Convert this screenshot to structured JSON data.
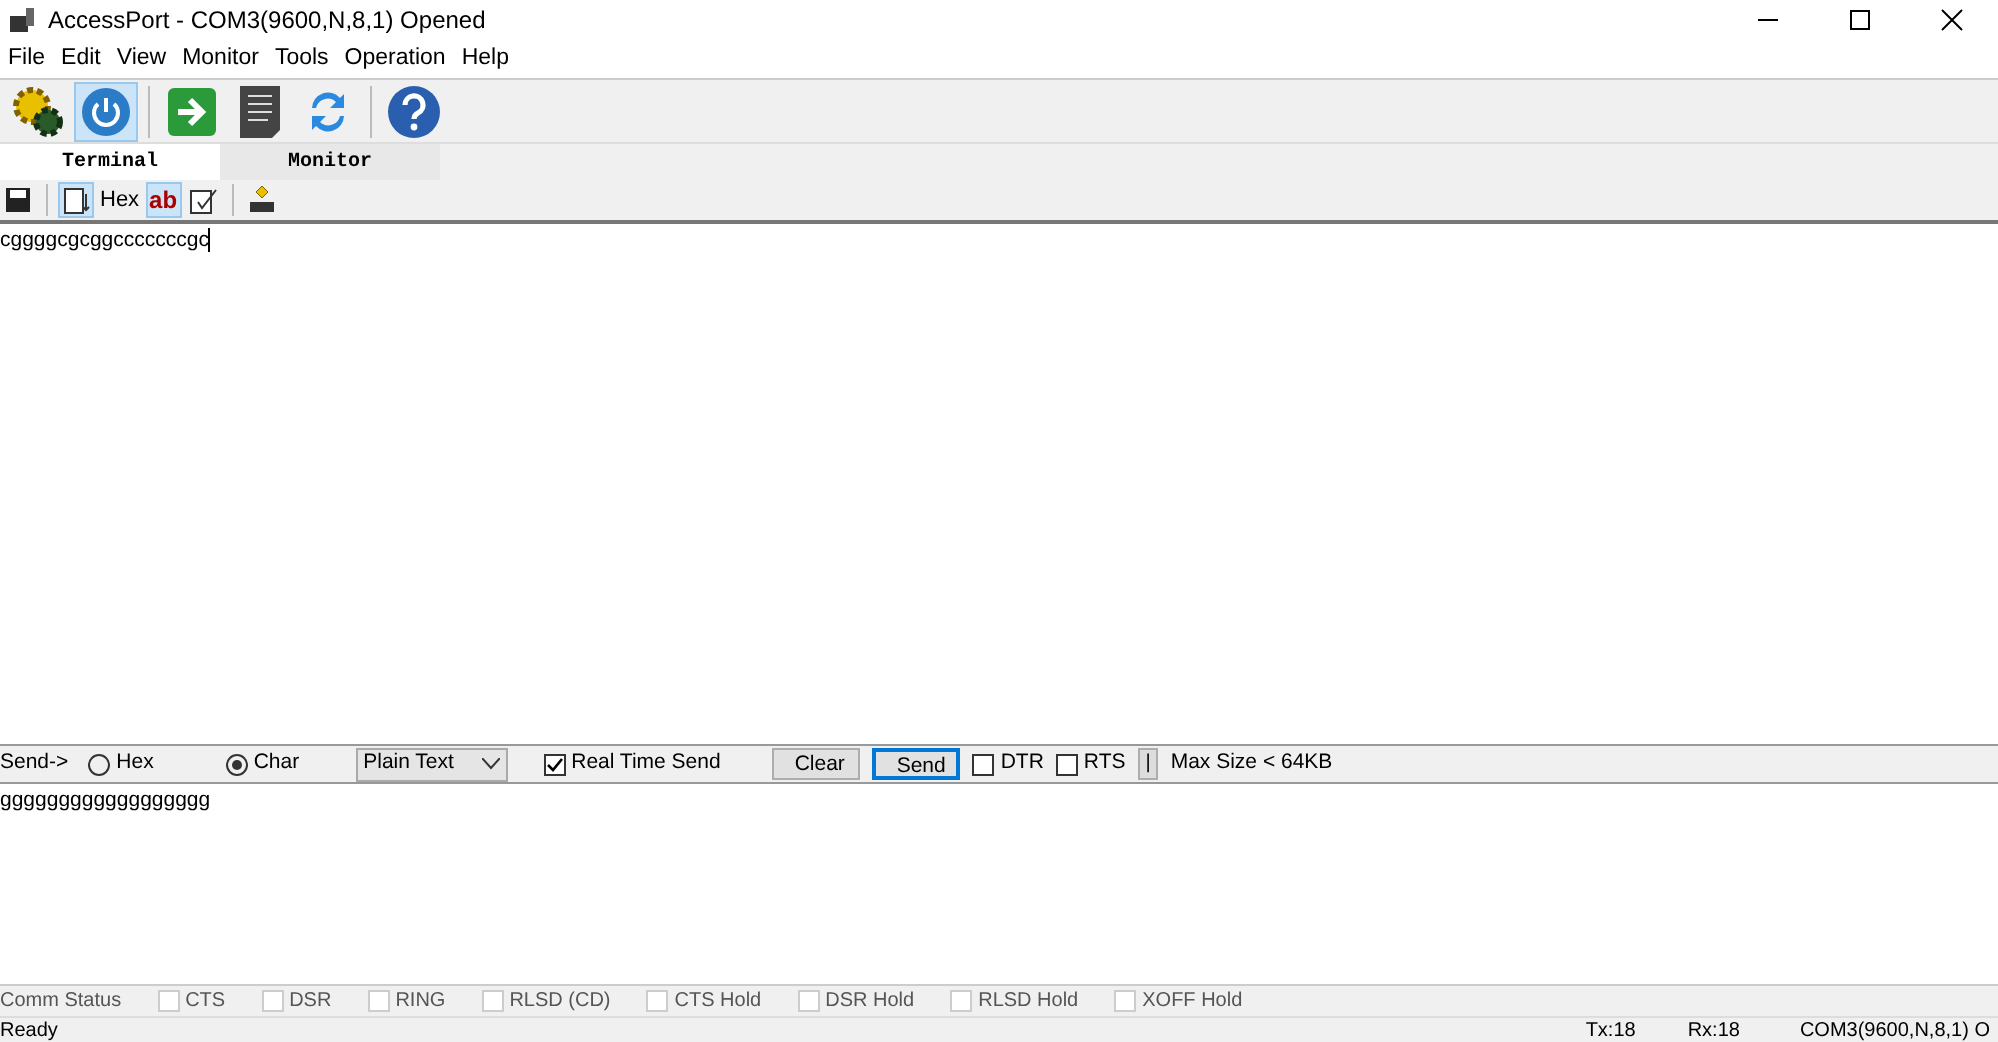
{
  "window": {
    "title": "AccessPort - COM3(9600,N,8,1) Opened"
  },
  "menu": [
    "File",
    "Edit",
    "View",
    "Monitor",
    "Tools",
    "Operation",
    "Help"
  ],
  "toolbar": [
    {
      "kind": "gear",
      "selected": false
    },
    {
      "kind": "power",
      "selected": true
    },
    {
      "kind": "sep"
    },
    {
      "kind": "arrow",
      "selected": false
    },
    {
      "kind": "doc",
      "selected": false
    },
    {
      "kind": "refresh",
      "selected": false
    },
    {
      "kind": "sep"
    },
    {
      "kind": "help",
      "selected": false
    }
  ],
  "tabs": [
    {
      "label": "Terminal",
      "selected": true
    },
    {
      "label": "Monitor",
      "selected": false
    }
  ],
  "terminal_toolbar": [
    {
      "kind": "save",
      "selected": false
    },
    {
      "kind": "sep"
    },
    {
      "kind": "scroll",
      "selected": true
    },
    {
      "kind": "text",
      "label": "Hex",
      "selected": false
    },
    {
      "kind": "text",
      "label": "ab",
      "selected": true
    },
    {
      "kind": "edit",
      "selected": false
    },
    {
      "kind": "sep"
    },
    {
      "kind": "crlf",
      "selected": false
    }
  ],
  "receive_text": "cggggcgcggcccccccgc",
  "send_bar": {
    "label": "Send->",
    "modes": [
      {
        "label": "Hex",
        "selected": false
      },
      {
        "label": "Char",
        "selected": true
      }
    ],
    "format": "Plain Text",
    "real_time": {
      "label": "Real Time Send",
      "checked": true
    },
    "buttons": [
      "Clear",
      "Send"
    ],
    "lines": [
      {
        "label": "DTR",
        "checked": false
      },
      {
        "label": "RTS",
        "checked": false
      }
    ],
    "pipe": "|",
    "max_size": "Max Size < 64KB"
  },
  "send_text": "gggggggggggggggggg",
  "comm_status": {
    "label": "Comm Status",
    "signals": [
      {
        "label": "CTS",
        "checked": false
      },
      {
        "label": "DSR",
        "checked": false
      },
      {
        "label": "RING",
        "checked": false
      },
      {
        "label": "RLSD (CD)",
        "checked": false
      },
      {
        "label": "CTS Hold",
        "checked": false
      },
      {
        "label": "DSR Hold",
        "checked": false
      },
      {
        "label": "RLSD Hold",
        "checked": false
      },
      {
        "label": "XOFF Hold",
        "checked": false
      }
    ]
  },
  "status_bar": {
    "message": "Ready",
    "tx": "Tx:18",
    "rx": "Rx:18",
    "port": "COM3(9600,N,8,1) O"
  }
}
